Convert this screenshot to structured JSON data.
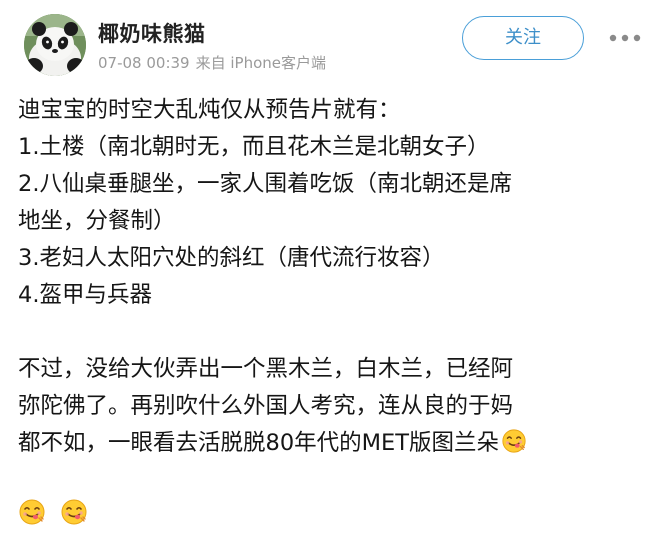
{
  "user": {
    "name": "椰奶味熊猫",
    "avatar_icon": "panda-avatar"
  },
  "meta": {
    "time": "07-08 00:39",
    "source": "来自 iPhone客户端"
  },
  "actions": {
    "follow_label": "关注",
    "more_icon": "more-dots-icon"
  },
  "post": {
    "lines": [
      "迪宝宝的时空大乱炖仅从预告片就有：",
      "1.土楼（南北朝时无，而且花木兰是北朝女子）",
      "2.八仙桌垂腿坐，一家人围着吃饭（南北朝还是席",
      "地坐，分餐制）",
      "3.老妇人太阳穴处的斜红（唐代流行妆容）",
      "4.盔甲与兵器",
      "",
      "不过，没给大伙弄出一个黑木兰，白木兰，已经阿",
      "弥陀佛了。再别吹什么外国人考究，连从良的于妈",
      "都不如，一眼看去活脱脱80年代的MET版图兰朵"
    ],
    "emoji_icon": "yummy-face-emoji-icon"
  },
  "colors": {
    "accent": "#3d8fc9",
    "meta_text": "#9a9a9a",
    "body_text": "#161616"
  }
}
